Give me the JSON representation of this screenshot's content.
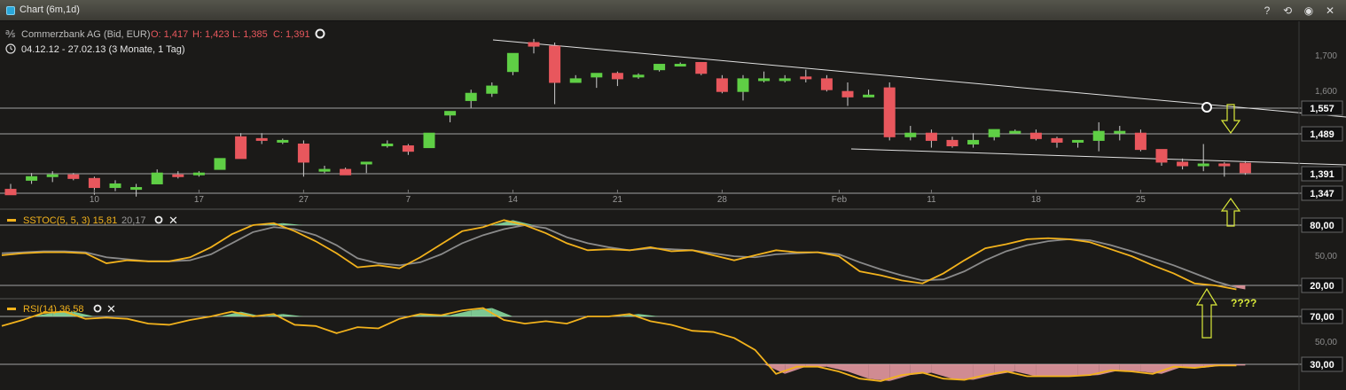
{
  "window": {
    "title": "Chart (6m,1d)",
    "buttons": [
      {
        "name": "help-button",
        "glyph": "?"
      },
      {
        "name": "reset-button",
        "glyph": "⟲"
      },
      {
        "name": "settings-button",
        "glyph": "◉"
      },
      {
        "name": "close-button",
        "glyph": "✕"
      }
    ]
  },
  "header": {
    "instrument": "Commerzbank AG (Bid, EUR)",
    "ohlc": [
      {
        "label": "O:",
        "value": "1,417"
      },
      {
        "label": "H:",
        "value": "1,423"
      },
      {
        "label": "L:",
        "value": "1,385"
      },
      {
        "label": "C:",
        "value": "1,391"
      }
    ],
    "range": "04.12.12 - 27.02.13 (3 Monate, 1 Tag)"
  },
  "colors": {
    "bg": "#1b1a18",
    "up": "#5fcf45",
    "down": "#e8575d",
    "line": "#f2b21c",
    "signal": "#8a8a8a",
    "overbought": "#8ee6a8",
    "oversold": "#f0a0a8",
    "arrow": "#d9e83a",
    "text": "#cfcfcf"
  },
  "price_axis": {
    "ticks": [
      "1,700",
      "1,600"
    ],
    "badges": [
      "1,557",
      "1,489",
      "1,391",
      "1,347"
    ]
  },
  "date_axis": [
    "10",
    "17",
    "27",
    "7",
    "14",
    "21",
    "28",
    "Feb",
    "11",
    "18",
    "25"
  ],
  "sstoc": {
    "label": "SSTOC(5, 5, 3)",
    "value1": "15,81",
    "value2": "20,17",
    "ticks": [
      "50,00"
    ],
    "badges": [
      "80,00",
      "20,00"
    ]
  },
  "rsi": {
    "label": "RSI(14)",
    "value": "36,58",
    "ticks": [
      "50,00"
    ],
    "badges": [
      "70,00",
      "30,00"
    ]
  },
  "annotation_text": "????",
  "chart_data": {
    "type": "candlestick",
    "y_axis_price": [
      1.3,
      1.75
    ],
    "candles": [
      [
        1.345,
        1.36,
        1.335,
        1.33
      ],
      [
        1.37,
        1.39,
        1.36,
        1.38
      ],
      [
        1.38,
        1.395,
        1.365,
        1.385
      ],
      [
        1.385,
        1.39,
        1.37,
        1.375
      ],
      [
        1.375,
        1.38,
        1.33,
        1.35
      ],
      [
        1.35,
        1.37,
        1.34,
        1.36
      ],
      [
        1.345,
        1.36,
        1.325,
        1.35
      ],
      [
        1.36,
        1.4,
        1.36,
        1.39
      ],
      [
        1.385,
        1.395,
        1.375,
        1.38
      ],
      [
        1.385,
        1.395,
        1.38,
        1.39
      ],
      [
        1.4,
        1.43,
        1.4,
        1.43
      ],
      [
        1.49,
        1.5,
        1.43,
        1.43
      ],
      [
        1.485,
        1.5,
        1.47,
        1.48
      ],
      [
        1.48,
        1.485,
        1.47,
        1.48
      ],
      [
        1.47,
        1.48,
        1.38,
        1.42
      ],
      [
        1.395,
        1.41,
        1.39,
        1.4
      ],
      [
        1.4,
        1.405,
        1.385,
        1.385
      ],
      [
        1.415,
        1.42,
        1.39,
        1.42
      ],
      [
        1.465,
        1.48,
        1.46,
        1.47
      ],
      [
        1.465,
        1.47,
        1.44,
        1.45
      ],
      [
        1.46,
        1.5,
        1.46,
        1.5
      ],
      [
        1.55,
        1.56,
        1.53,
        1.56
      ],
      [
        1.59,
        1.62,
        1.57,
        1.61
      ],
      [
        1.61,
        1.64,
        1.6,
        1.63
      ],
      [
        1.67,
        1.71,
        1.66,
        1.72
      ],
      [
        1.75,
        1.76,
        1.72,
        1.74
      ],
      [
        1.74,
        1.75,
        1.58,
        1.64
      ],
      [
        1.64,
        1.66,
        1.64,
        1.65
      ],
      [
        1.655,
        1.665,
        1.625,
        1.665
      ],
      [
        1.665,
        1.67,
        1.63,
        1.65
      ],
      [
        1.655,
        1.665,
        1.65,
        1.66
      ],
      [
        1.675,
        1.69,
        1.67,
        1.69
      ],
      [
        1.69,
        1.695,
        1.685,
        1.69
      ],
      [
        1.695,
        1.695,
        1.66,
        1.665
      ],
      [
        1.65,
        1.66,
        1.61,
        1.615
      ],
      [
        1.615,
        1.66,
        1.59,
        1.65
      ],
      [
        1.645,
        1.67,
        1.64,
        1.65
      ],
      [
        1.65,
        1.66,
        1.64,
        1.65
      ],
      [
        1.655,
        1.675,
        1.64,
        1.65
      ],
      [
        1.65,
        1.66,
        1.615,
        1.62
      ],
      [
        1.615,
        1.64,
        1.575,
        1.6
      ],
      [
        1.6,
        1.62,
        1.6,
        1.605
      ],
      [
        1.625,
        1.64,
        1.48,
        1.49
      ],
      [
        1.49,
        1.52,
        1.48,
        1.5
      ],
      [
        1.5,
        1.51,
        1.46,
        1.48
      ],
      [
        1.48,
        1.49,
        1.46,
        1.465
      ],
      [
        1.47,
        1.5,
        1.46,
        1.48
      ],
      [
        1.49,
        1.51,
        1.48,
        1.51
      ],
      [
        1.505,
        1.51,
        1.5,
        1.505
      ],
      [
        1.5,
        1.51,
        1.48,
        1.485
      ],
      [
        1.485,
        1.49,
        1.46,
        1.475
      ],
      [
        1.475,
        1.48,
        1.46,
        1.48
      ],
      [
        1.48,
        1.53,
        1.45,
        1.505
      ],
      [
        1.505,
        1.52,
        1.48,
        1.505
      ],
      [
        1.5,
        1.51,
        1.45,
        1.455
      ],
      [
        1.455,
        1.455,
        1.41,
        1.42
      ],
      [
        1.42,
        1.43,
        1.4,
        1.41
      ],
      [
        1.41,
        1.47,
        1.395,
        1.415
      ],
      [
        1.415,
        1.42,
        1.38,
        1.41
      ],
      [
        1.417,
        1.423,
        1.385,
        1.391
      ]
    ],
    "sstoc_k": [
      50,
      52,
      53,
      53,
      52,
      42,
      45,
      44,
      44,
      48,
      58,
      71,
      80,
      82,
      74,
      64,
      52,
      38,
      40,
      37,
      48,
      61,
      74,
      78,
      85,
      80,
      72,
      62,
      55,
      56,
      55,
      58,
      54,
      55,
      50,
      45,
      50,
      55,
      53,
      53,
      49,
      34,
      30,
      25,
      22,
      32,
      45,
      57,
      61,
      66,
      67,
      66,
      63,
      56,
      49,
      40,
      32,
      22,
      20,
      16
    ],
    "sstoc_d": [
      52,
      53,
      54,
      54,
      53,
      48,
      46,
      44,
      44,
      45,
      51,
      62,
      73,
      78,
      76,
      70,
      60,
      47,
      42,
      40,
      43,
      51,
      62,
      70,
      76,
      80,
      77,
      68,
      62,
      58,
      55,
      57,
      56,
      55,
      52,
      49,
      48,
      51,
      52,
      53,
      51,
      43,
      36,
      30,
      25,
      26,
      34,
      45,
      54,
      60,
      64,
      66,
      65,
      60,
      54,
      47,
      40,
      32,
      24,
      18
    ]
  }
}
